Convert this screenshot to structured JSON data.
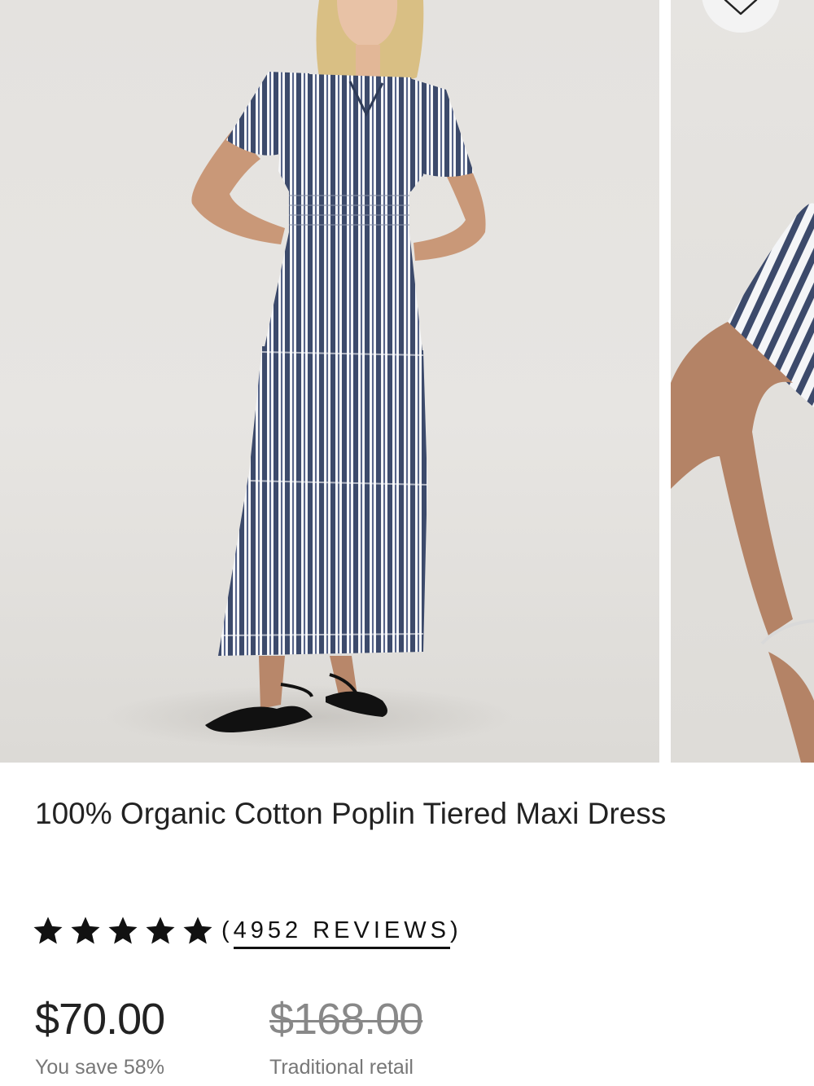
{
  "product": {
    "title": "100% Organic Cotton Poplin Tiered Maxi Dress",
    "rating": 5,
    "rating_max": 5,
    "reviews_open": "(",
    "reviews_text": "4952 REVIEWS",
    "reviews_close": ")",
    "price": "$70.00",
    "savings": "You save 58%",
    "retail_price": "$168.00",
    "retail_label": "Traditional retail"
  },
  "colors": {
    "stripe_navy": "#3c4a6b",
    "stripe_white": "#f4f5f7",
    "backdrop": "#e4e2df"
  },
  "icons": {
    "wishlist": "heart-icon",
    "rating": "star-icon"
  }
}
